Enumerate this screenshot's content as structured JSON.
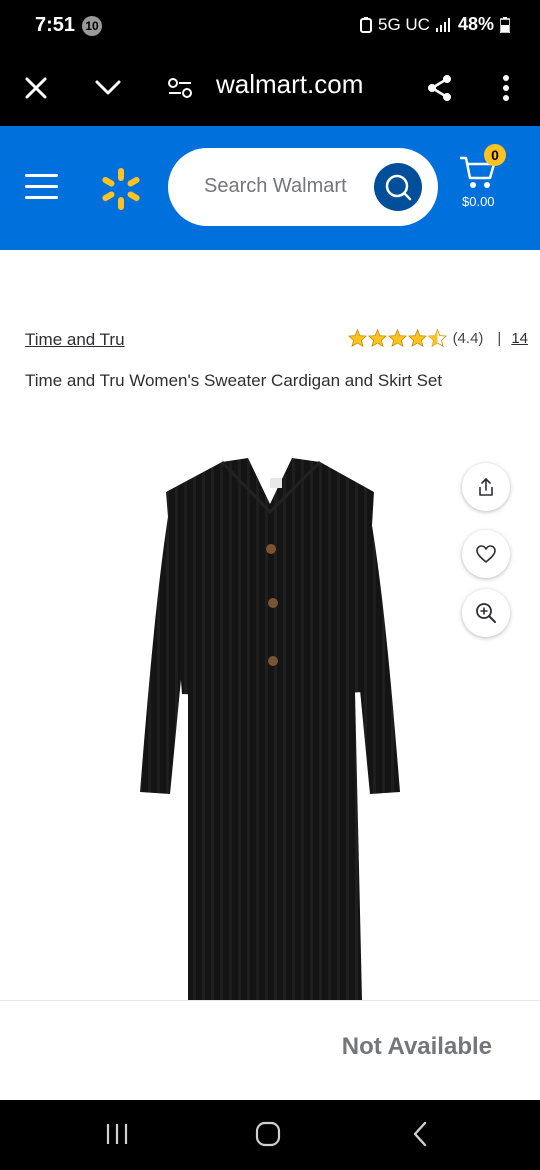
{
  "status_bar": {
    "time": "7:51",
    "notification_count": "10",
    "network": "5G UC",
    "battery": "48%"
  },
  "browser": {
    "url": "walmart.com",
    "icons": [
      "close-icon",
      "chevron-down-icon",
      "site-settings-icon",
      "share-icon",
      "more-vert-icon"
    ]
  },
  "header": {
    "search_placeholder": "Search Walmart",
    "cart_count": "0",
    "cart_total": "$0.00",
    "colors": {
      "brand_blue": "#0071dc",
      "spark_yellow": "#ffc220",
      "search_button": "#004f9a"
    }
  },
  "product": {
    "brand": "Time and Tru",
    "rating_value": "(4.4)",
    "rating_stars": 4.4,
    "review_count": "14",
    "title": "Time and Tru Women's Sweater Cardigan and Skirt Set",
    "image_icons": [
      "share-icon",
      "heart-icon",
      "zoom-in-icon"
    ]
  },
  "availability": {
    "status": "Not Available"
  },
  "nav_bar": {
    "icons": [
      "recent-apps-icon",
      "home-icon",
      "back-icon"
    ]
  }
}
